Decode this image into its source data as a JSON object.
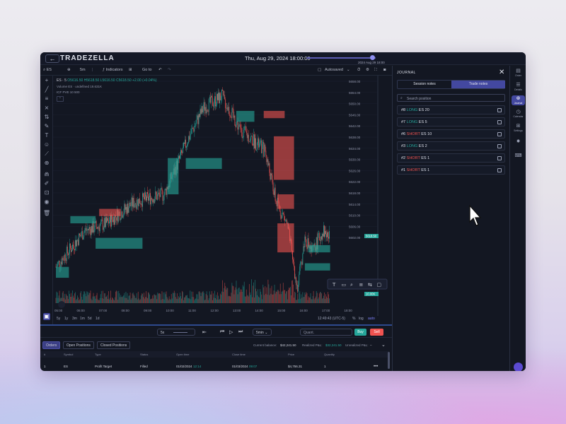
{
  "window": {
    "logo": "TRADEZELLA",
    "title": "Thu, Aug 29, 2024 18:00:00",
    "replay_date": "2024 Aug 29 18:00"
  },
  "toolbar": {
    "symbol": "ES",
    "interval": "5m",
    "indicators": "Indicators",
    "goto": "Go to",
    "autosaved": "Autosaved"
  },
  "chart_overlay": {
    "title": "ES · 5",
    "ohlc": "O5616.50 H5618.50 L5616.50 C5618.50 +2.00 (+0.04%)",
    "volume": "Volume ES · undefined  19.631K",
    "icf": "ICF PVE 10 500"
  },
  "chart_data": {
    "type": "candlestick",
    "x_ticks": [
      "05:00",
      "06:00",
      "07:00",
      "08:00",
      "09:00",
      "10:00",
      "11:00",
      "12:00",
      "13:00",
      "14:00",
      "15:00",
      "16:00",
      "17:00",
      "18:00"
    ],
    "y_ticks": [
      "5658.00",
      "5654.00",
      "5650.00",
      "5646.00",
      "5642.00",
      "5638.00",
      "5634.00",
      "5630.00",
      "5626.00",
      "5622.00",
      "5618.00",
      "5614.00",
      "5610.00",
      "5606.00",
      "5602.00"
    ],
    "last_price": "5618.50",
    "bottom_tag": "10.00K",
    "ylim": [
      5600,
      5660
    ]
  },
  "timeframes": [
    "5y",
    "1y",
    "3m",
    "1m",
    "5d",
    "1d"
  ],
  "chart_clock": "12:49:43 (UTC-5)",
  "chart_scale_opts": [
    "%",
    "log",
    "auto"
  ],
  "controls": {
    "speed": "5x",
    "interval": "5min",
    "quantity_placeholder": "Quant.",
    "buy": "Buy",
    "sell": "Sell"
  },
  "orders": {
    "tabs": [
      "Orders",
      "Open Positions",
      "Closed Positions"
    ],
    "balance_label": "Current balance:",
    "balance": "$42,241.50",
    "realized_label": "Realized P&L:",
    "realized": "$32,241.50",
    "unrealized_label": "Unrealized P&L:",
    "unrealized": "–",
    "columns": [
      "#",
      "Symbol",
      "Type",
      "Status",
      "Open time",
      "Close time",
      "Price",
      "Quantity"
    ],
    "rows": [
      {
        "n": "1",
        "symbol": "ES",
        "type": "Profit Target",
        "status": "Filled",
        "open": "01/02/2024",
        "open_t": "12:14",
        "close": "01/03/2024",
        "close_t": "09:07",
        "price": "$4,756.31",
        "qty": "1"
      }
    ]
  },
  "journal": {
    "title": "JOURNAL",
    "tabs": [
      "Session notes",
      "Trade notes"
    ],
    "search_placeholder": "Search position",
    "items": [
      {
        "id": "#8",
        "side": "LONG",
        "sym": "ES",
        "qty": "20"
      },
      {
        "id": "#7",
        "side": "LONG",
        "sym": "ES",
        "qty": "5"
      },
      {
        "id": "#6",
        "side": "SHORT",
        "sym": "ES",
        "qty": "10"
      },
      {
        "id": "#3",
        "side": "LONG",
        "sym": "ES",
        "qty": "2"
      },
      {
        "id": "#2",
        "side": "SHORT",
        "sym": "ES",
        "qty": "1"
      },
      {
        "id": "#1",
        "side": "SHORT",
        "sym": "ES",
        "qty": "1"
      }
    ]
  },
  "rail": [
    "Order",
    "Details",
    "Journal",
    "Calendar",
    "Settings"
  ],
  "colors": {
    "up": "#26a69a",
    "down": "#ef5350",
    "accent": "#4348a0"
  }
}
